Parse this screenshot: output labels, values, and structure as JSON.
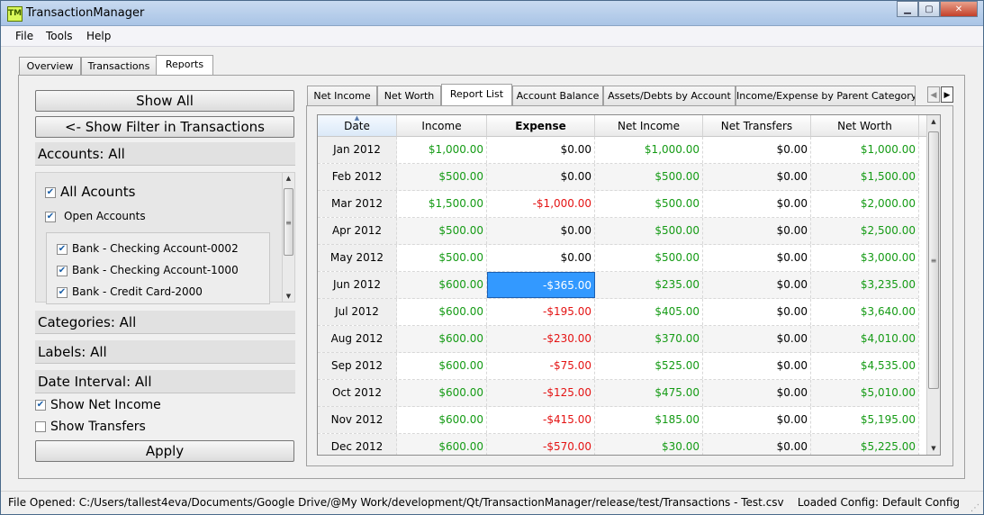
{
  "window": {
    "title": "TransactionManager",
    "icon_text": "TM"
  },
  "menu": [
    "File",
    "Tools",
    "Help"
  ],
  "main_tabs": [
    "Overview",
    "Transactions",
    "Reports"
  ],
  "filter": {
    "show_all": "Show All",
    "show_filter": "<- Show Filter in Transactions",
    "accounts_header": "Accounts: All",
    "all_accounts": "All Acounts",
    "open_accounts": "Open Accounts",
    "account_items": [
      "Bank - Checking Account-0002",
      "Bank - Checking Account-1000",
      "Bank - Credit Card-2000"
    ],
    "categories_header": "Categories: All",
    "labels_header": "Labels: All",
    "date_interval_header": "Date Interval: All",
    "show_net_income": "Show Net Income",
    "show_transfers": "Show Transfers",
    "apply": "Apply"
  },
  "report_tabs": [
    "Net Income",
    "Net Worth",
    "Report List",
    "Account Balance",
    "Assets/Debts by Account",
    "Income/Expense by Parent Category"
  ],
  "table": {
    "columns": [
      "Date",
      "Income",
      "Expense",
      "Net Income",
      "Net Transfers",
      "Net Worth"
    ],
    "rows": [
      [
        "Jan 2012",
        "$1,000.00",
        "$0.00",
        "$1,000.00",
        "$0.00",
        "$1,000.00"
      ],
      [
        "Feb 2012",
        "$500.00",
        "$0.00",
        "$500.00",
        "$0.00",
        "$1,500.00"
      ],
      [
        "Mar 2012",
        "$1,500.00",
        "-$1,000.00",
        "$500.00",
        "$0.00",
        "$2,000.00"
      ],
      [
        "Apr 2012",
        "$500.00",
        "$0.00",
        "$500.00",
        "$0.00",
        "$2,500.00"
      ],
      [
        "May 2012",
        "$500.00",
        "$0.00",
        "$500.00",
        "$0.00",
        "$3,000.00"
      ],
      [
        "Jun 2012",
        "$600.00",
        "-$365.00",
        "$235.00",
        "$0.00",
        "$3,235.00"
      ],
      [
        "Jul 2012",
        "$600.00",
        "-$195.00",
        "$405.00",
        "$0.00",
        "$3,640.00"
      ],
      [
        "Aug 2012",
        "$600.00",
        "-$230.00",
        "$370.00",
        "$0.00",
        "$4,010.00"
      ],
      [
        "Sep 2012",
        "$600.00",
        "-$75.00",
        "$525.00",
        "$0.00",
        "$4,535.00"
      ],
      [
        "Oct 2012",
        "$600.00",
        "-$125.00",
        "$475.00",
        "$0.00",
        "$5,010.00"
      ],
      [
        "Nov 2012",
        "$600.00",
        "-$415.00",
        "$185.00",
        "$0.00",
        "$5,195.00"
      ],
      [
        "Dec 2012",
        "$600.00",
        "-$570.00",
        "$30.00",
        "$0.00",
        "$5,225.00"
      ]
    ]
  },
  "status": {
    "left": "File Opened: C:/Users/tallest4eva/Documents/Google Drive/@My Work/development/Qt/TransactionManager/release/test/Transactions - Test.csv",
    "right": "Loaded Config: Default Config"
  },
  "colors": {
    "positive": "#159b15",
    "negative": "#e41414",
    "selection": "#3399ff"
  }
}
